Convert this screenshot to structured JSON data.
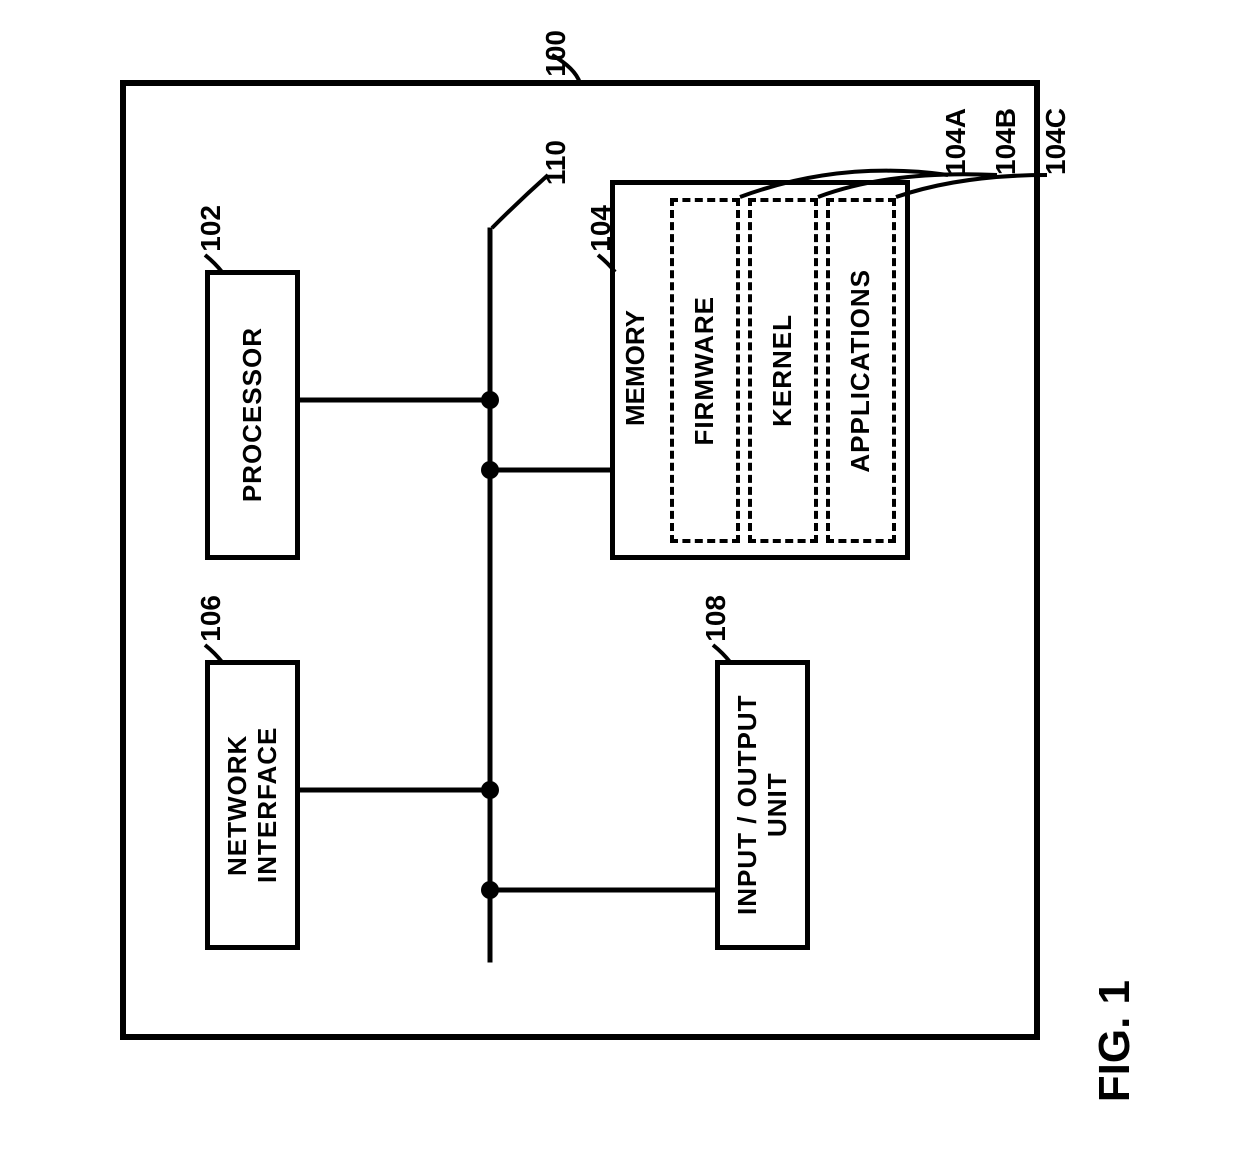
{
  "figure_label": "FIG. 1",
  "refs": {
    "device": "100",
    "bus": "110",
    "processor": "102",
    "memory": "104",
    "firmware": "104A",
    "kernel": "104B",
    "applications": "104C",
    "network_interface": "106",
    "io_unit": "108"
  },
  "blocks": {
    "processor": "PROCESSOR",
    "memory": "MEMORY",
    "firmware": "FIRMWARE",
    "kernel": "KERNEL",
    "applications": "APPLICATIONS",
    "network_interface": "NETWORK INTERFACE",
    "io_unit": "INPUT / OUTPUT UNIT"
  }
}
